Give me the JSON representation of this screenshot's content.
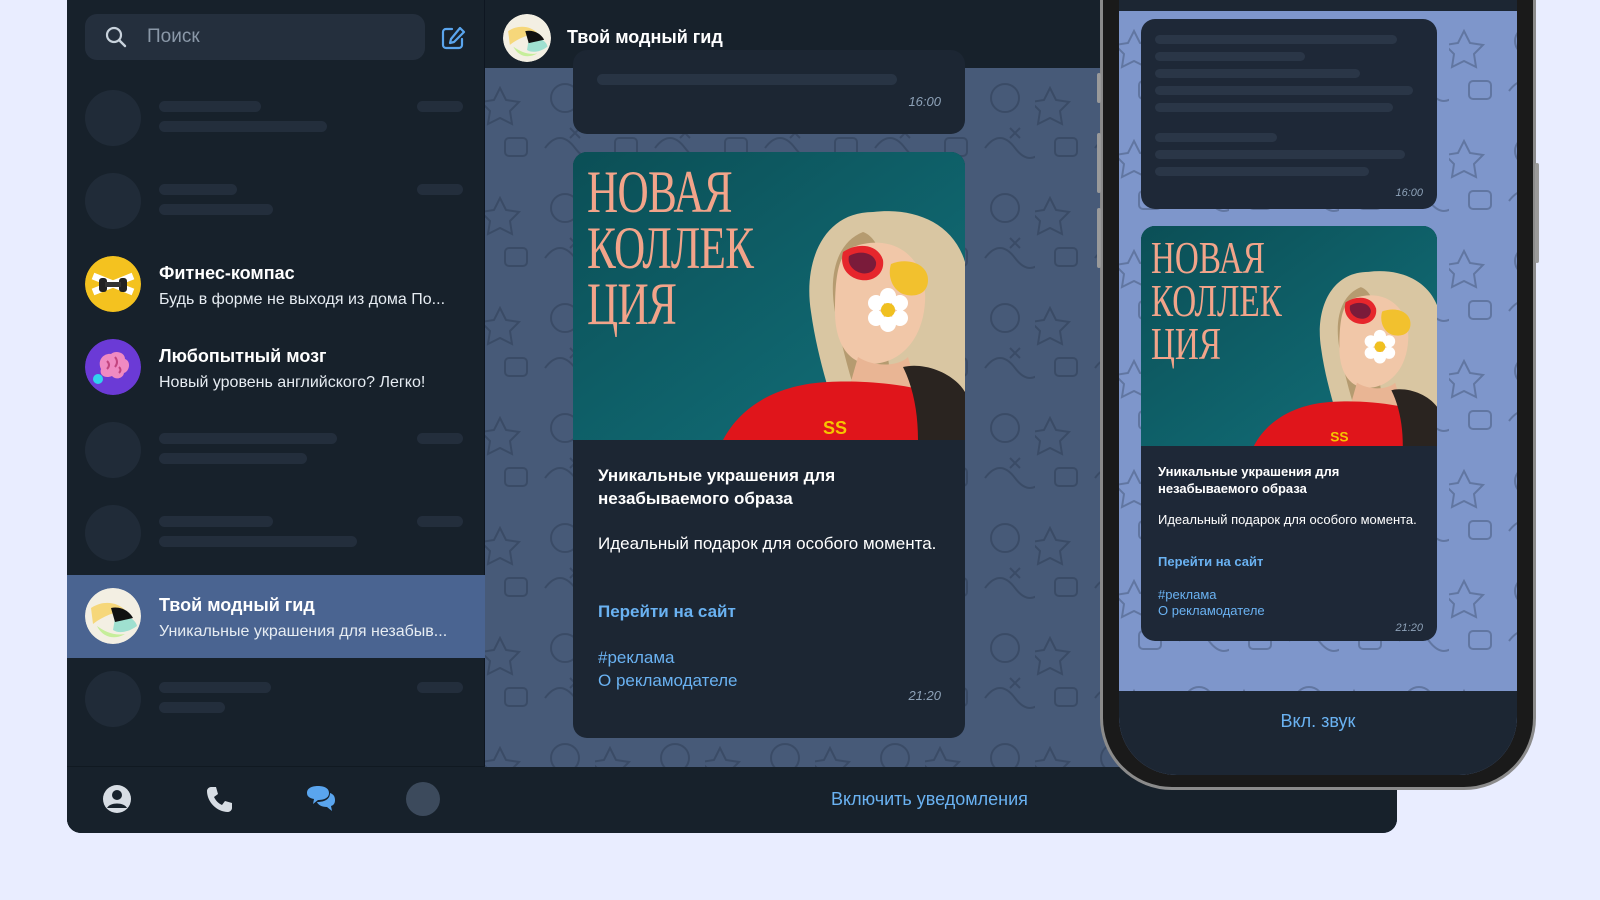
{
  "search": {
    "placeholder": "Поиск"
  },
  "chats": [
    {
      "title": "Фитнес-компас",
      "preview": "Будь в форме не выходя из дома  По..."
    },
    {
      "title": "Любопытный мозг",
      "preview": "Новый уровень английского? Легко!"
    },
    {
      "title": "Твой модный гид",
      "preview": "Уникальные украшения для незабыв..."
    }
  ],
  "active_chat": {
    "title": "Твой модный гид"
  },
  "messages": {
    "previous_time": "16:00",
    "promo_image_text": [
      "НОВАЯ",
      "КОЛЛЕК",
      "ЦИЯ"
    ],
    "ad_title": "Уникальные украшения для незабываемого образа",
    "ad_text": "Идеальный подарок для особого момента.",
    "ad_link": "Перейти на сайт",
    "ad_tag": "#реклама",
    "ad_advertiser": "О рекламодателе",
    "ad_time": "21:20"
  },
  "footer": {
    "notify_label": "Включить уведомления"
  },
  "phone": {
    "sound_label": "Вкл. звук"
  },
  "colors": {
    "accent": "#6ab2f2",
    "active_row": "#4a6491",
    "app_bg": "#17212b",
    "chat_bg": "#475a78",
    "phone_chat_bg": "#7e96cb",
    "page_bg": "#e9edff"
  }
}
